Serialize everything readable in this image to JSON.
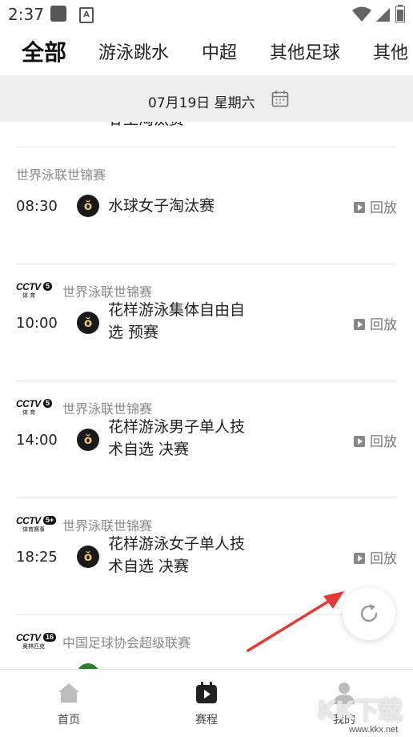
{
  "status_bar": {
    "time": "2:37",
    "notif_letter": "A"
  },
  "tabs": [
    {
      "label": "全部",
      "active": true
    },
    {
      "label": "游泳跳水"
    },
    {
      "label": "中超"
    },
    {
      "label": "其他足球"
    },
    {
      "label": "其他"
    }
  ],
  "date_bar": {
    "date": "07月19日",
    "weekday": "星期六"
  },
  "list": {
    "partial_title": "甘王淘汰赛",
    "sections": [
      {
        "logo": "",
        "competition": "世界泳联世锦赛",
        "time": "08:30",
        "title_lines": [
          "水球女子淘汰赛"
        ],
        "replay": "回放"
      },
      {
        "logo": "CCTV5",
        "logo_num": "5",
        "logo_sub": "体 育",
        "competition": "世界泳联世锦赛",
        "time": "10:00",
        "title_lines": [
          "花样游泳集体自由自",
          "选 预赛"
        ],
        "replay": "回放"
      },
      {
        "logo": "CCTV5",
        "logo_num": "5",
        "logo_sub": "体 育",
        "competition": "世界泳联世锦赛",
        "time": "14:00",
        "title_lines": [
          "花样游泳男子单人技",
          "术自选 决赛"
        ],
        "replay": "回放"
      },
      {
        "logo": "CCTV5+",
        "logo_num": "5+",
        "logo_sub": "体育赛事",
        "competition": "世界泳联世锦赛",
        "time": "18:25",
        "title_lines": [
          "花样游泳女子单人技",
          "术自选 决赛"
        ],
        "replay": "回放"
      },
      {
        "logo": "CCTV16",
        "logo_num": "16",
        "logo_sub": "奥林匹克",
        "competition": "中国足球协会超级联赛",
        "time": "",
        "title_lines": [],
        "replay": ""
      }
    ]
  },
  "bottom_nav": [
    {
      "label": "首页",
      "icon": "home-icon"
    },
    {
      "label": "赛程",
      "icon": "schedule-icon"
    },
    {
      "label": "我的",
      "icon": "profile-icon"
    }
  ],
  "watermark": {
    "text": "KK下载",
    "url": "www.kkx.net"
  },
  "colors": {
    "accent": "#111111",
    "date_bar_bg": "#eeeeee",
    "muted": "#888888",
    "arrow": "#e53935"
  }
}
